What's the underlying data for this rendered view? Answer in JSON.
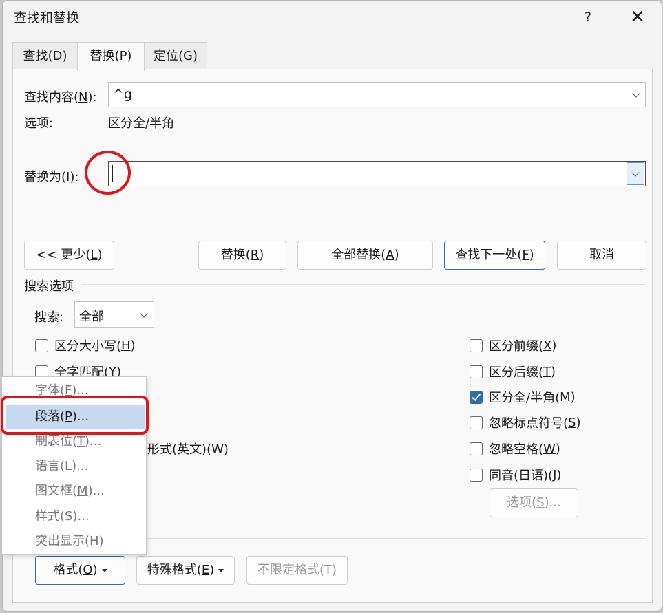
{
  "window": {
    "title": "查找和替换",
    "help": "?",
    "close": "✕"
  },
  "tabs": [
    {
      "label": "查找(D)",
      "pre": "查找(",
      "key": "D",
      "post": ")"
    },
    {
      "label": "替换(P)",
      "pre": "替换(",
      "key": "P",
      "post": ")"
    },
    {
      "label": "定位(G)",
      "pre": "定位(",
      "key": "G",
      "post": ")"
    }
  ],
  "find": {
    "label_pre": "查找内容(",
    "label_key": "N",
    "label_post": "):",
    "value": "^g"
  },
  "options": {
    "label": "选项:",
    "value": "区分全/半角"
  },
  "replace": {
    "label_pre": "替换为(",
    "label_key": "I",
    "label_post": "):",
    "value": ""
  },
  "buttons": {
    "less": {
      "pre": "<< 更少(",
      "key": "L",
      "post": ")"
    },
    "replace": {
      "pre": "替换(",
      "key": "R",
      "post": ")"
    },
    "replace_all": {
      "pre": "全部替换(",
      "key": "A",
      "post": ")"
    },
    "find_next": {
      "pre": "查找下一处(",
      "key": "F",
      "post": ")"
    },
    "cancel": "取消"
  },
  "search_options": {
    "title": "搜索选项",
    "search_label": "搜索:",
    "search_value": "全部"
  },
  "checkboxes_left": [
    {
      "pre": "区分大小写(",
      "key": "H",
      "post": ")",
      "checked": false
    },
    {
      "pre": "全字匹配(",
      "key": "Y",
      "post": ")",
      "checked": false
    }
  ],
  "partial_left_text": "形式(英文)(W)",
  "checkboxes_right": [
    {
      "pre": "区分前缀(",
      "key": "X",
      "post": ")",
      "checked": false
    },
    {
      "pre": "区分后缀(",
      "key": "T",
      "post": ")",
      "checked": false
    },
    {
      "pre": "区分全/半角(",
      "key": "M",
      "post": ")",
      "checked": true
    },
    {
      "pre": "忽略标点符号(",
      "key": "S",
      "post": ")",
      "checked": false
    },
    {
      "pre": "忽略空格(",
      "key": "W",
      "post": ")",
      "checked": false
    },
    {
      "pre": "同音(日语)(",
      "key": "J",
      "post": ")",
      "checked": false
    }
  ],
  "options_button": {
    "pre": "选项(",
    "key": "S",
    "post": ")..."
  },
  "format_menu": [
    {
      "pre": "字体(",
      "key": "F",
      "post": ")..."
    },
    {
      "pre": "段落(",
      "key": "P",
      "post": ")...",
      "highlighted": true
    },
    {
      "pre": "制表位(",
      "key": "T",
      "post": ")..."
    },
    {
      "pre": "语言(",
      "key": "L",
      "post": ")..."
    },
    {
      "pre": "图文框(",
      "key": "M",
      "post": ")..."
    },
    {
      "pre": "样式(",
      "key": "S",
      "post": ")..."
    },
    {
      "pre": "突出显示(",
      "key": "H",
      "post": ")"
    }
  ],
  "bottom_buttons": {
    "format": {
      "pre": "格式(",
      "key": "O",
      "post": ")"
    },
    "special": {
      "pre": "特殊格式(",
      "key": "E",
      "post": ")"
    },
    "no_format": "不限定格式(T)"
  },
  "colors": {
    "accent": "#2e6ea8",
    "annotation_red": "#e0141b",
    "menu_highlight": "#c7d9ee"
  }
}
